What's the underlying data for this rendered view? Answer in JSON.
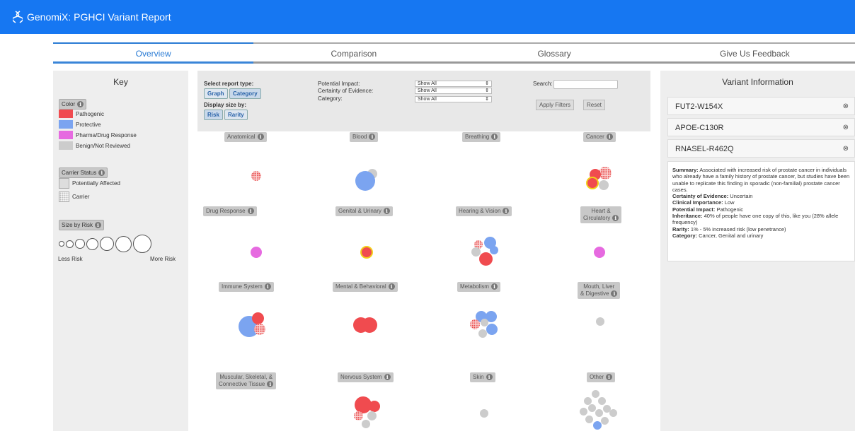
{
  "app": {
    "title": "GenomiX: PGHCI Variant Report"
  },
  "tabs": [
    {
      "label": "Overview",
      "active": true
    },
    {
      "label": "Comparison",
      "active": false
    },
    {
      "label": "Glossary",
      "active": false
    },
    {
      "label": "Give Us Feedback",
      "active": false
    }
  ],
  "key": {
    "title": "Key",
    "color_label": "Color",
    "colors": [
      {
        "label": "Pathogenic",
        "color": "#f04b4f"
      },
      {
        "label": "Protective",
        "color": "#7ba4f0"
      },
      {
        "label": "Pharma/Drug Response",
        "color": "#e66ae0"
      },
      {
        "label": "Benign/Not Reviewed",
        "color": "#cccccc"
      }
    ],
    "carrier_label": "Carrier Status",
    "carrier_items": [
      {
        "label": "Potentially Affected"
      },
      {
        "label": "Carrier"
      }
    ],
    "size_label": "Size by Risk",
    "less": "Less Risk",
    "more": "More Risk"
  },
  "filters": {
    "report_type_label": "Select report type:",
    "graph_btn": "Graph",
    "category_btn": "Category",
    "display_size_label": "Display size by:",
    "risk_btn": "Risk",
    "rarity_btn": "Rarity",
    "impact_label": "Potential Impact:",
    "certainty_label": "Certainty of Evidence:",
    "category_label": "Category:",
    "impact_value": "Show All",
    "certainty_value": "Show All",
    "category_value": "Show All",
    "search_label": "Search:",
    "search_value": "",
    "apply_btn": "Apply Filters",
    "reset_btn": "Reset"
  },
  "categories": [
    {
      "label": "Anatomical"
    },
    {
      "label": "Blood"
    },
    {
      "label": "Breathing"
    },
    {
      "label": "Cancer"
    },
    {
      "label": "Drug Response"
    },
    {
      "label": "Genital & Urinary"
    },
    {
      "label": "Hearing & Vision"
    },
    {
      "label": "Heart &",
      "label2": "Circulatory"
    },
    {
      "label": "Immune System"
    },
    {
      "label": "Mental & Behavioral"
    },
    {
      "label": "Metabolism"
    },
    {
      "label": "Mouth, Liver",
      "label2": "& Digestive"
    },
    {
      "label": "Muscular, Skeletal, &",
      "label2": "Connective Tissue"
    },
    {
      "label": "Nervous System"
    },
    {
      "label": "Skin"
    },
    {
      "label": "Other"
    }
  ],
  "variant_info": {
    "title": "Variant Information",
    "variants": [
      {
        "name": "FUT2-W154X"
      },
      {
        "name": "APOE-C130R"
      },
      {
        "name": "RNASEL-R462Q"
      }
    ],
    "detail": {
      "summary_label": "Summary:",
      "summary": "Associated with increased risk of prostate cancer in individuals who already have a family history of prostate cancer, but studies have been unable to replicate this finding in sporadic (non-familial) prostate cancer cases.",
      "certainty_label": "Certainty of Evidence:",
      "certainty": "Uncertain",
      "importance_label": "Clinical Importance:",
      "importance": "Low",
      "impact_label": "Potential Impact:",
      "impact": "Pathogenic",
      "inheritance_label": "Inheritance:",
      "inheritance": "40% of people have one copy of this, like you (28% allele frequency)",
      "rarity_label": "Rarity:",
      "rarity": "1% - 5% increased risk (low penetrance)",
      "category_label": "Category:",
      "category": "Cancer, Genital and urinary"
    }
  }
}
